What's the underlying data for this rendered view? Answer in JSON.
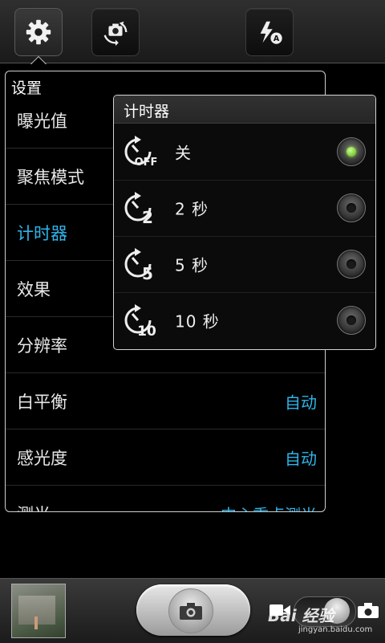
{
  "toolbar": {
    "settings_icon": "gear-icon",
    "switch_camera_icon": "switch-camera-icon",
    "flash_icon": "flash-auto-icon"
  },
  "settings": {
    "title": "设置",
    "items": [
      {
        "label": "曝光值",
        "value": ""
      },
      {
        "label": "聚焦模式",
        "value": ""
      },
      {
        "label": "计时器",
        "value": ""
      },
      {
        "label": "效果",
        "value": ""
      },
      {
        "label": "分辨率",
        "value": ""
      },
      {
        "label": "白平衡",
        "value": "自动"
      },
      {
        "label": "感光度",
        "value": "自动"
      },
      {
        "label": "测光",
        "value": "中心重点测光"
      }
    ],
    "selected_index": 2
  },
  "timer_popup": {
    "title": "计时器",
    "options": [
      {
        "label": "关",
        "icon_text": "OFF",
        "icon": "timer-off-icon",
        "selected": true
      },
      {
        "label": "2 秒",
        "icon_text": "2",
        "icon": "timer-2s-icon",
        "selected": false
      },
      {
        "label": "5 秒",
        "icon_text": "5",
        "icon": "timer-5s-icon",
        "selected": false
      },
      {
        "label": "10 秒",
        "icon_text": "10",
        "icon": "timer-10s-icon",
        "selected": false
      }
    ]
  },
  "bottom": {
    "watermark": "Bai 经验",
    "watermark_url": "jingyan.baidu.com"
  },
  "colors": {
    "accent": "#2fb5ea",
    "radio_on": "#7ac82f"
  }
}
